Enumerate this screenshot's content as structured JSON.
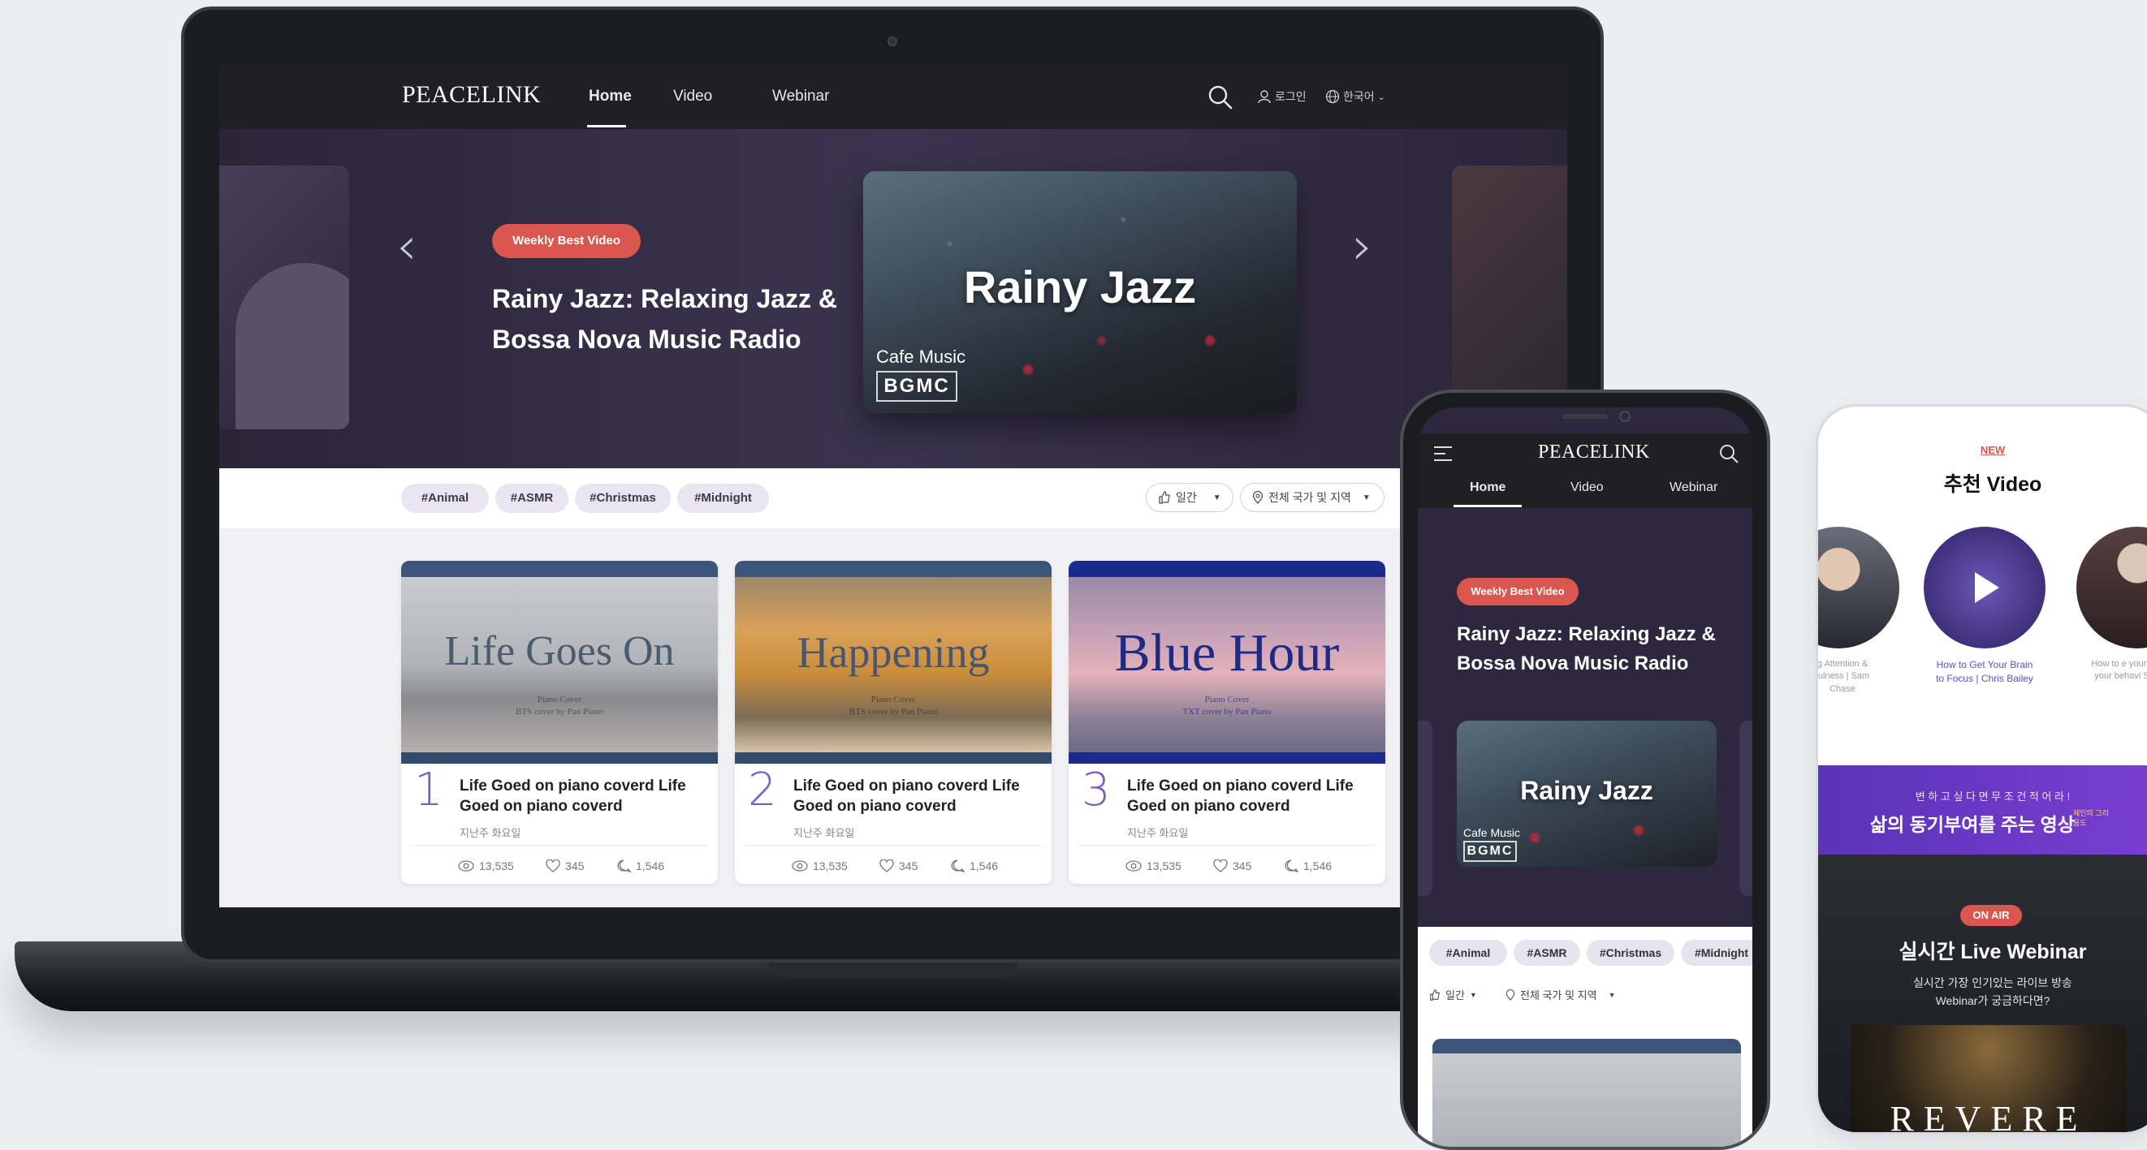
{
  "brand": {
    "logo": "PEACELINK"
  },
  "nav": {
    "tabs": [
      {
        "label": "Home"
      },
      {
        "label": "Video"
      },
      {
        "label": "Webinar"
      }
    ],
    "login_label": "로그인",
    "language_label": "한국어"
  },
  "hero": {
    "badge": "Weekly Best Video",
    "title_line1": "Rainy Jazz: Relaxing Jazz &",
    "title_line2": "Bossa Nova Music Radio",
    "thumbnail": {
      "title": "Rainy Jazz",
      "subtitle": "Cafe Music",
      "logo_text": "BGMC"
    }
  },
  "tags": [
    "#Animal",
    "#ASMR",
    "#Christmas",
    "#Midnight"
  ],
  "filters": {
    "period": "일간",
    "region": "전체 국가 및 지역"
  },
  "cards": [
    {
      "rank": "1",
      "image_title": "Life Goes On",
      "image_sub1": "Piano Cover",
      "image_sub2": "BTS cover by Pan Piano",
      "title_line1": "Life Goed on piano coverd Life",
      "title_line2": "Goed on piano coverd",
      "date": "지난주 화요일",
      "views": "13,535",
      "likes": "345",
      "comments": "1,546"
    },
    {
      "rank": "2",
      "image_title": "Happening",
      "image_sub1": "Piano Cover",
      "image_sub2": "BTS cover by Pan Piano",
      "title_line1": "Life Goed on piano coverd Life",
      "title_line2": "Goed on piano coverd",
      "date": "지난주 화요일",
      "views": "13,535",
      "likes": "345",
      "comments": "1,546"
    },
    {
      "rank": "3",
      "image_title": "Blue Hour",
      "image_sub1": "Piano Cover",
      "image_sub2": "TXT cover by Pan Piano",
      "title_line1": "Life Goed on piano coverd Life",
      "title_line2": "Goed on piano coverd",
      "date": "지난주 화요일",
      "views": "13,535",
      "likes": "345",
      "comments": "1,546"
    }
  ],
  "mobile": {
    "tabs": [
      "Home",
      "Video",
      "Webinar"
    ],
    "tags": [
      "#Animal",
      "#ASMR",
      "#Christmas",
      "#Midnight"
    ],
    "period": "일간",
    "region": "전체 국가 및 지역"
  },
  "recommend": {
    "new_label": "NEW",
    "heading": "추천 Video",
    "items": [
      {
        "caption": "g Attention & fulness | Sam Chase"
      },
      {
        "caption_line1": "How to Get Your Brain",
        "caption_line2": "to Focus | Chris Bailey"
      },
      {
        "caption": "How to e yourself to your behavi Shere"
      }
    ],
    "band_small": "변 하 고 싶 다 면 무 조 건 적 어 라 !",
    "band_big": "삶의 동기부여를 주는 영상",
    "band_tag": "제인의 그리움도",
    "onair": "ON AIR",
    "live_title": "실시간 Live Webinar",
    "live_sub1": "실시간 가장 인기있는 라이브 방송",
    "live_sub2": "Webinar가 궁금하다면?",
    "live_banner": "REVERE"
  },
  "colors": {
    "accent_badge": "#d9574e",
    "accent_purple": "#7b5fc0",
    "nav_bg": "#1f1f24",
    "hero_bg": "#3a3450"
  }
}
